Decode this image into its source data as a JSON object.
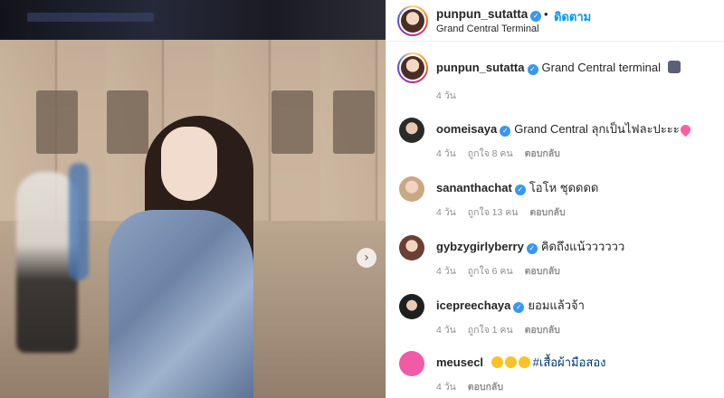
{
  "photo": {
    "next_icon": "chevron-right-icon",
    "next_glyph": "›"
  },
  "header": {
    "username": "punpun_sutatta",
    "follow_label": "ติดตาม",
    "separator": "•",
    "location": "Grand Central Terminal"
  },
  "caption": {
    "username": "punpun_sutatta",
    "text": "Grand Central terminal",
    "time": "4 วัน"
  },
  "comments": [
    {
      "username": "oomeisaya",
      "verified": true,
      "text": "Grand Central ลุกเป็นไฟละปะะะ",
      "emoji": "two-hearts",
      "time": "4 วัน",
      "likes": "ถูกใจ 8 คน",
      "reply": "ตอบกลับ"
    },
    {
      "username": "sananthachat",
      "verified": true,
      "text": "โอโห ชุดดดด",
      "time": "4 วัน",
      "likes": "ถูกใจ 13 คน",
      "reply": "ตอบกลับ"
    },
    {
      "username": "gybzygirlyberry",
      "verified": true,
      "text": "คิดถึงแน้วววววว",
      "time": "4 วัน",
      "likes": "ถูกใจ 6 คน",
      "reply": "ตอบกลับ"
    },
    {
      "username": "icepreechaya",
      "verified": true,
      "text": "ยอมแล้วจ้า",
      "time": "4 วัน",
      "likes": "ถูกใจ 1 คน",
      "reply": "ตอบกลับ"
    },
    {
      "username": "meusecl",
      "verified": false,
      "text": "#เสื้อผ้ามือสอง",
      "emoji": "heart-eyes-x3",
      "time": "4 วัน",
      "likes": "",
      "reply": "ตอบกลับ"
    }
  ],
  "colors": {
    "accent": "#0095f6",
    "verified": "#3897f0",
    "meta": "#8e8e8e"
  }
}
